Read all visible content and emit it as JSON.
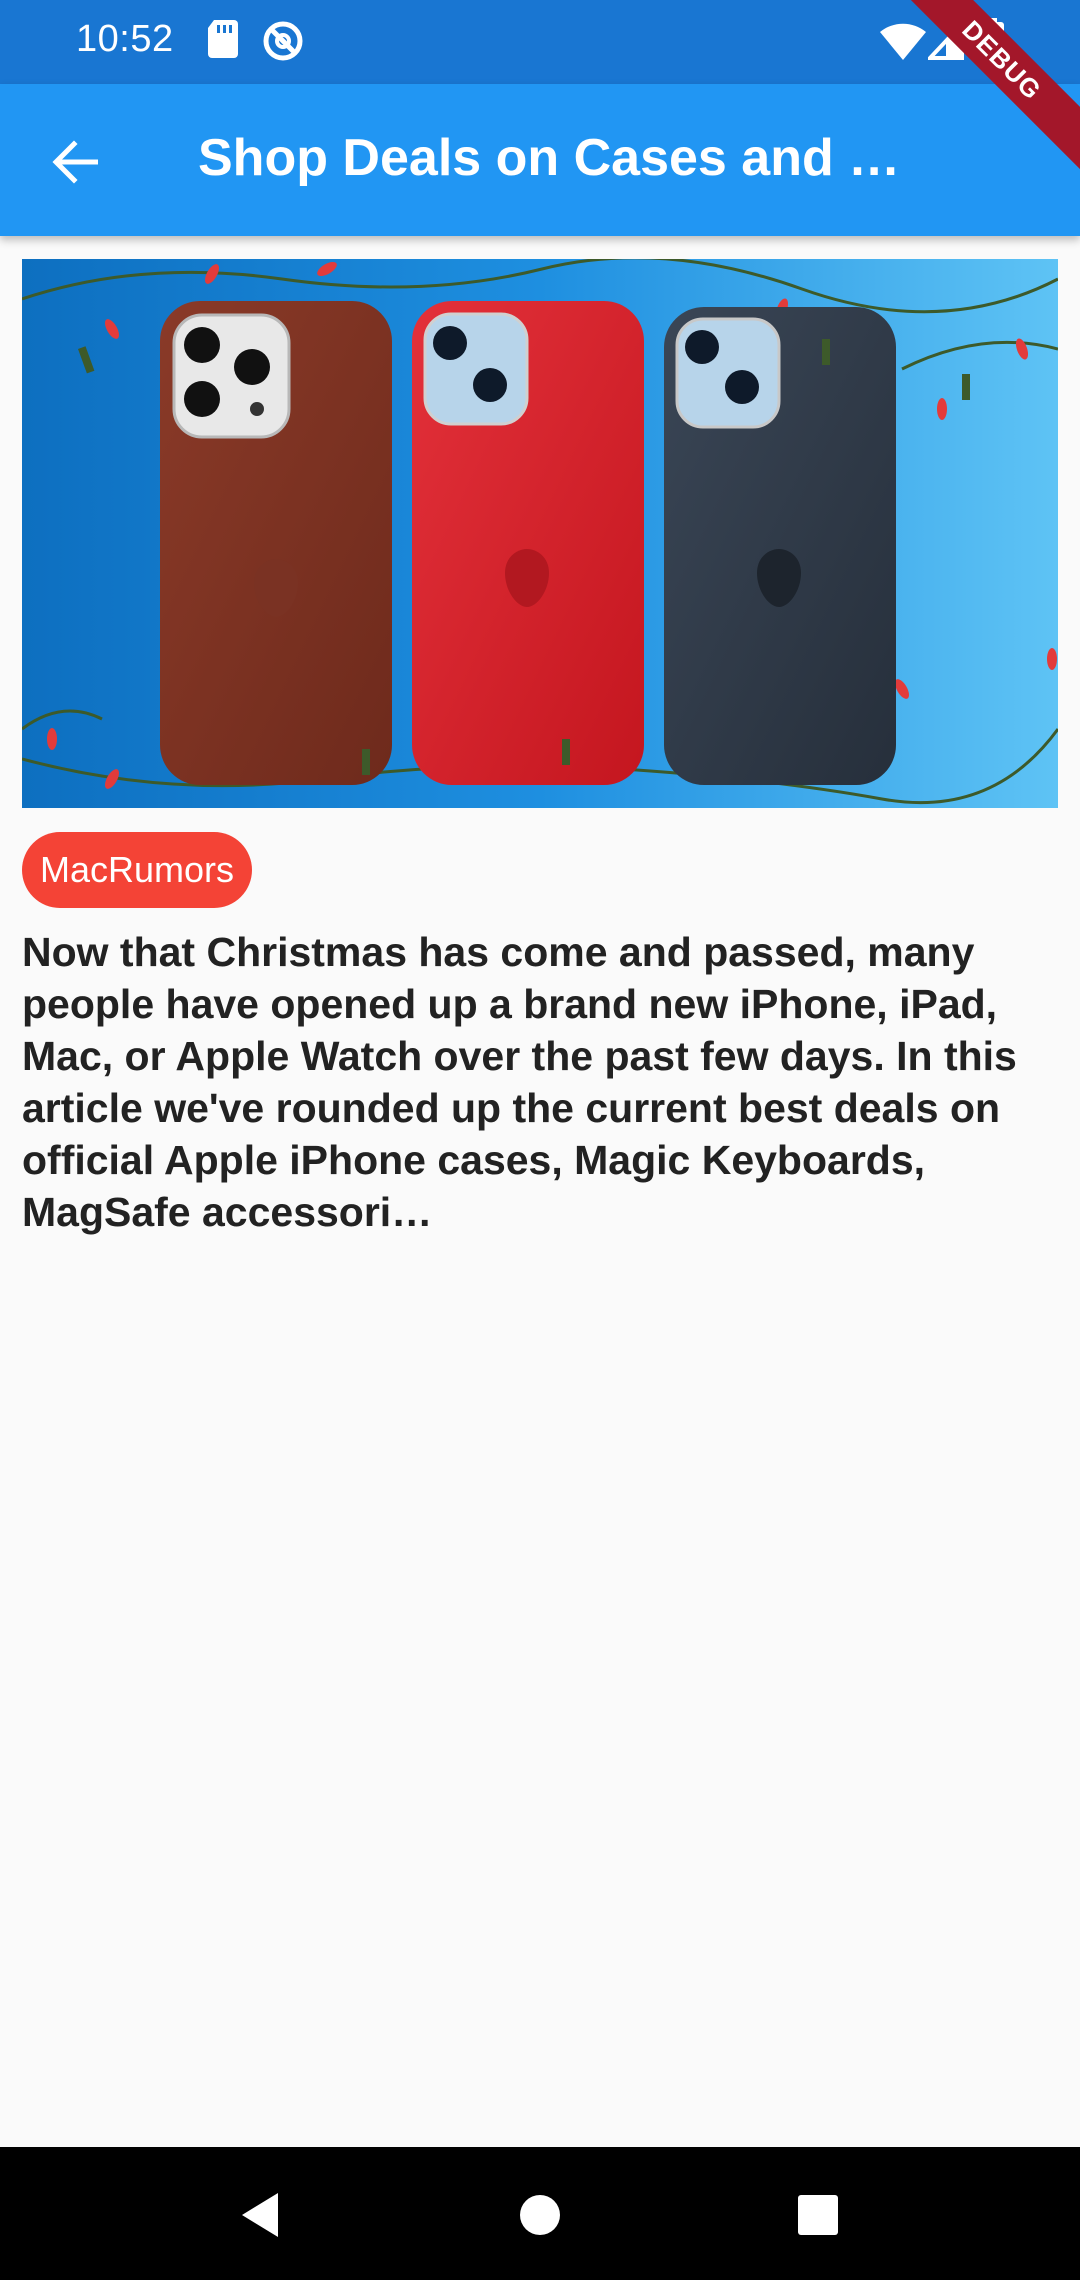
{
  "status_bar": {
    "time": "10:52",
    "icons": [
      "sd-card-icon",
      "vpn-icon",
      "wifi-icon",
      "signal-icon",
      "battery-icon"
    ]
  },
  "app_bar": {
    "title": "Shop Deals on Cases and …",
    "back_icon": "arrow-back-icon",
    "background": "#2196f3"
  },
  "debug_banner": "DEBUG",
  "article": {
    "image_description_icon": "hero-image",
    "source_chip": "MacRumors",
    "chip_color": "#f44336",
    "summary": "Now that Christmas has come and passed, many people have opened up a brand new iPhone, iPad, Mac, or Apple Watch over the past few days. In this article we've rounded up the current best deals on official Apple iPhone cases, Magic Keyboards, MagSafe accessori…"
  },
  "nav_bar": {
    "buttons": [
      "back-nav-icon",
      "home-nav-icon",
      "recents-nav-icon"
    ]
  }
}
